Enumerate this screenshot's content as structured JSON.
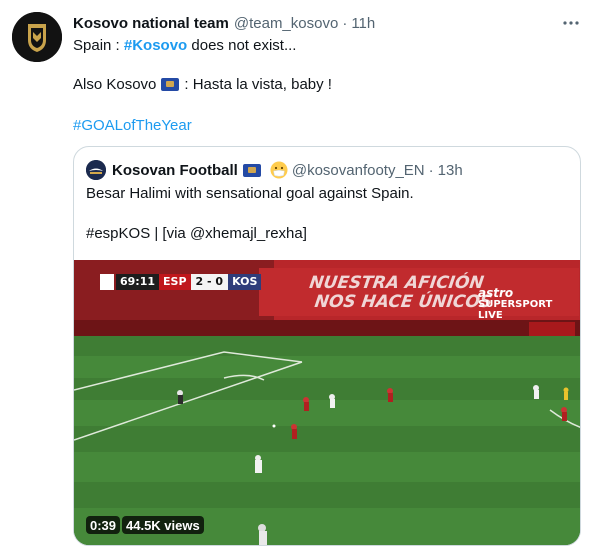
{
  "tweet": {
    "author_name": "Kosovo national team",
    "author_handle": "@team_kosovo",
    "separator": "·",
    "time": "11h",
    "line1_prefix": "Spain : ",
    "line1_hashtag": "#Kosovo",
    "line1_suffix": " does not exist...",
    "line2_prefix": "Also Kosovo",
    "line2_suffix": ": Hasta la vista, baby !",
    "line3_hashtag": "#GOALofTheYear",
    "more_icon": "more-icon"
  },
  "quote": {
    "author_name": "Kosovan Football",
    "author_handle": "@kosovanfooty_EN",
    "separator": "·",
    "time": "13h",
    "text_line1": "Besar Halimi with sensational goal against Spain.",
    "text_line2": "#espKOS | [via @xhemajl_rexha]"
  },
  "video": {
    "scorebug": {
      "clock": "69:11",
      "team1": "ESP",
      "score": "2 - 0",
      "team2": "KOS"
    },
    "banner_line1": "NUESTRA AFICIÓN",
    "banner_line2": "NOS HACE ÚNICOS",
    "broadcaster": "astro",
    "channel": "SUPERSPORT",
    "live": "LIVE",
    "duration": "0:39",
    "views": "44.5K views"
  },
  "colors": {
    "link": "#1d9bf0",
    "muted": "#536471",
    "border": "#cfd9de",
    "pitch": "#3f7d34"
  }
}
